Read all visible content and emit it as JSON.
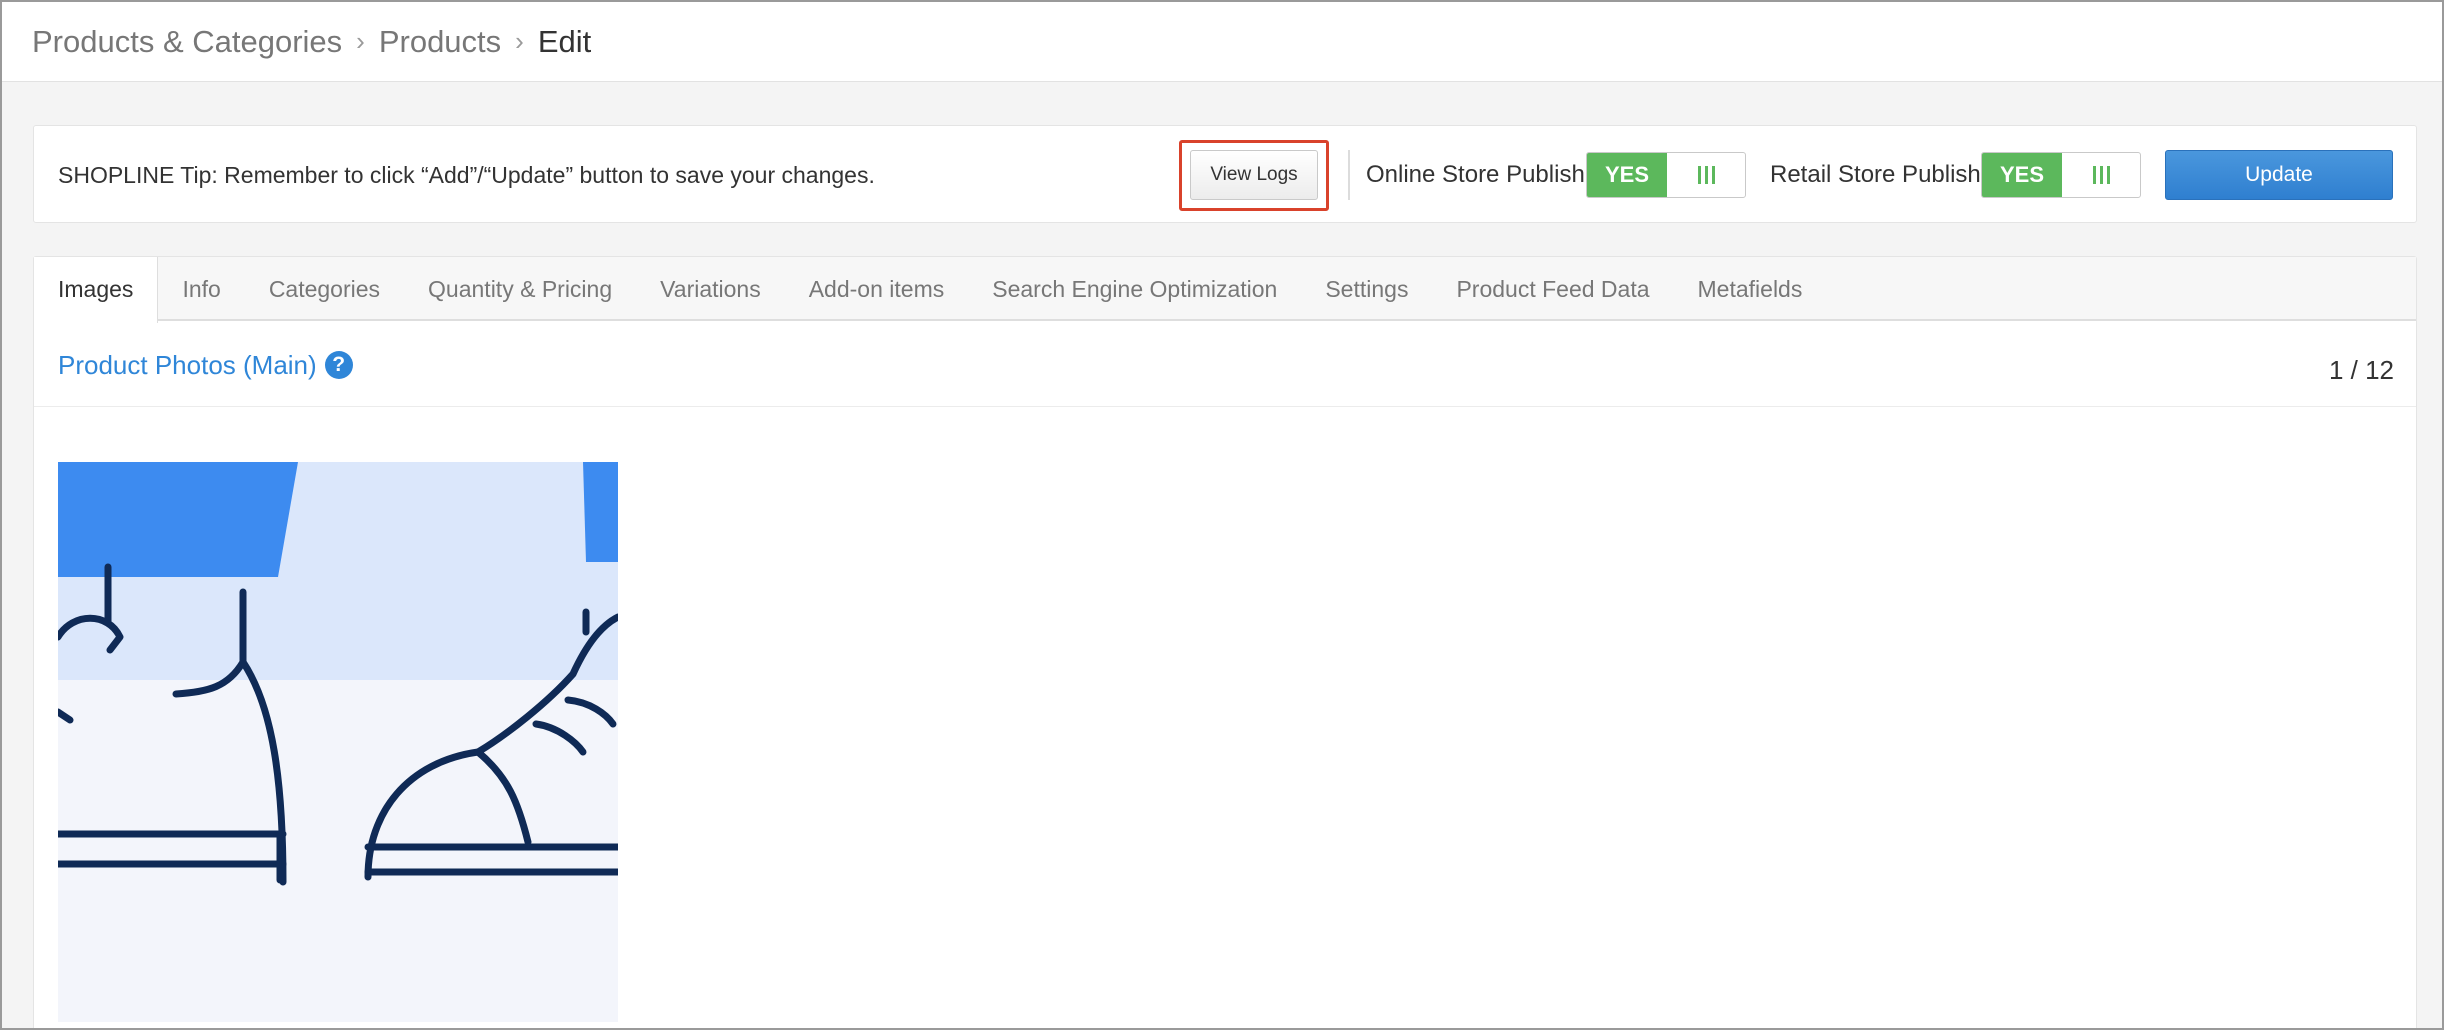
{
  "breadcrumb": {
    "items": [
      "Products & Categories",
      "Products"
    ],
    "current": "Edit"
  },
  "tipbar": {
    "tip": "SHOPLINE Tip: Remember to click “Add”/“Update” button to save your changes.",
    "view_logs": "View Logs",
    "online_label": "Online Store Publish",
    "online_state": "YES",
    "retail_label": "Retail Store Publish",
    "retail_state": "YES",
    "update": "Update"
  },
  "tabs": [
    "Images",
    "Info",
    "Categories",
    "Quantity & Pricing",
    "Variations",
    "Add-on items",
    "Search Engine Optimization",
    "Settings",
    "Product Feed Data",
    "Metafields"
  ],
  "section": {
    "title": "Product Photos (Main)",
    "count": "1 / 12"
  },
  "icons": {
    "help": "question-circle-icon",
    "breadcrumb_sep": "chevron-right-icon",
    "toggle_grip": "grip-bars-icon"
  },
  "colors": {
    "accent": "#2f86d8",
    "publish_on": "#5cb85c",
    "highlight": "#d9422b",
    "illustration_blue": "#3d8bf0",
    "illustration_navy": "#0f2a56"
  }
}
